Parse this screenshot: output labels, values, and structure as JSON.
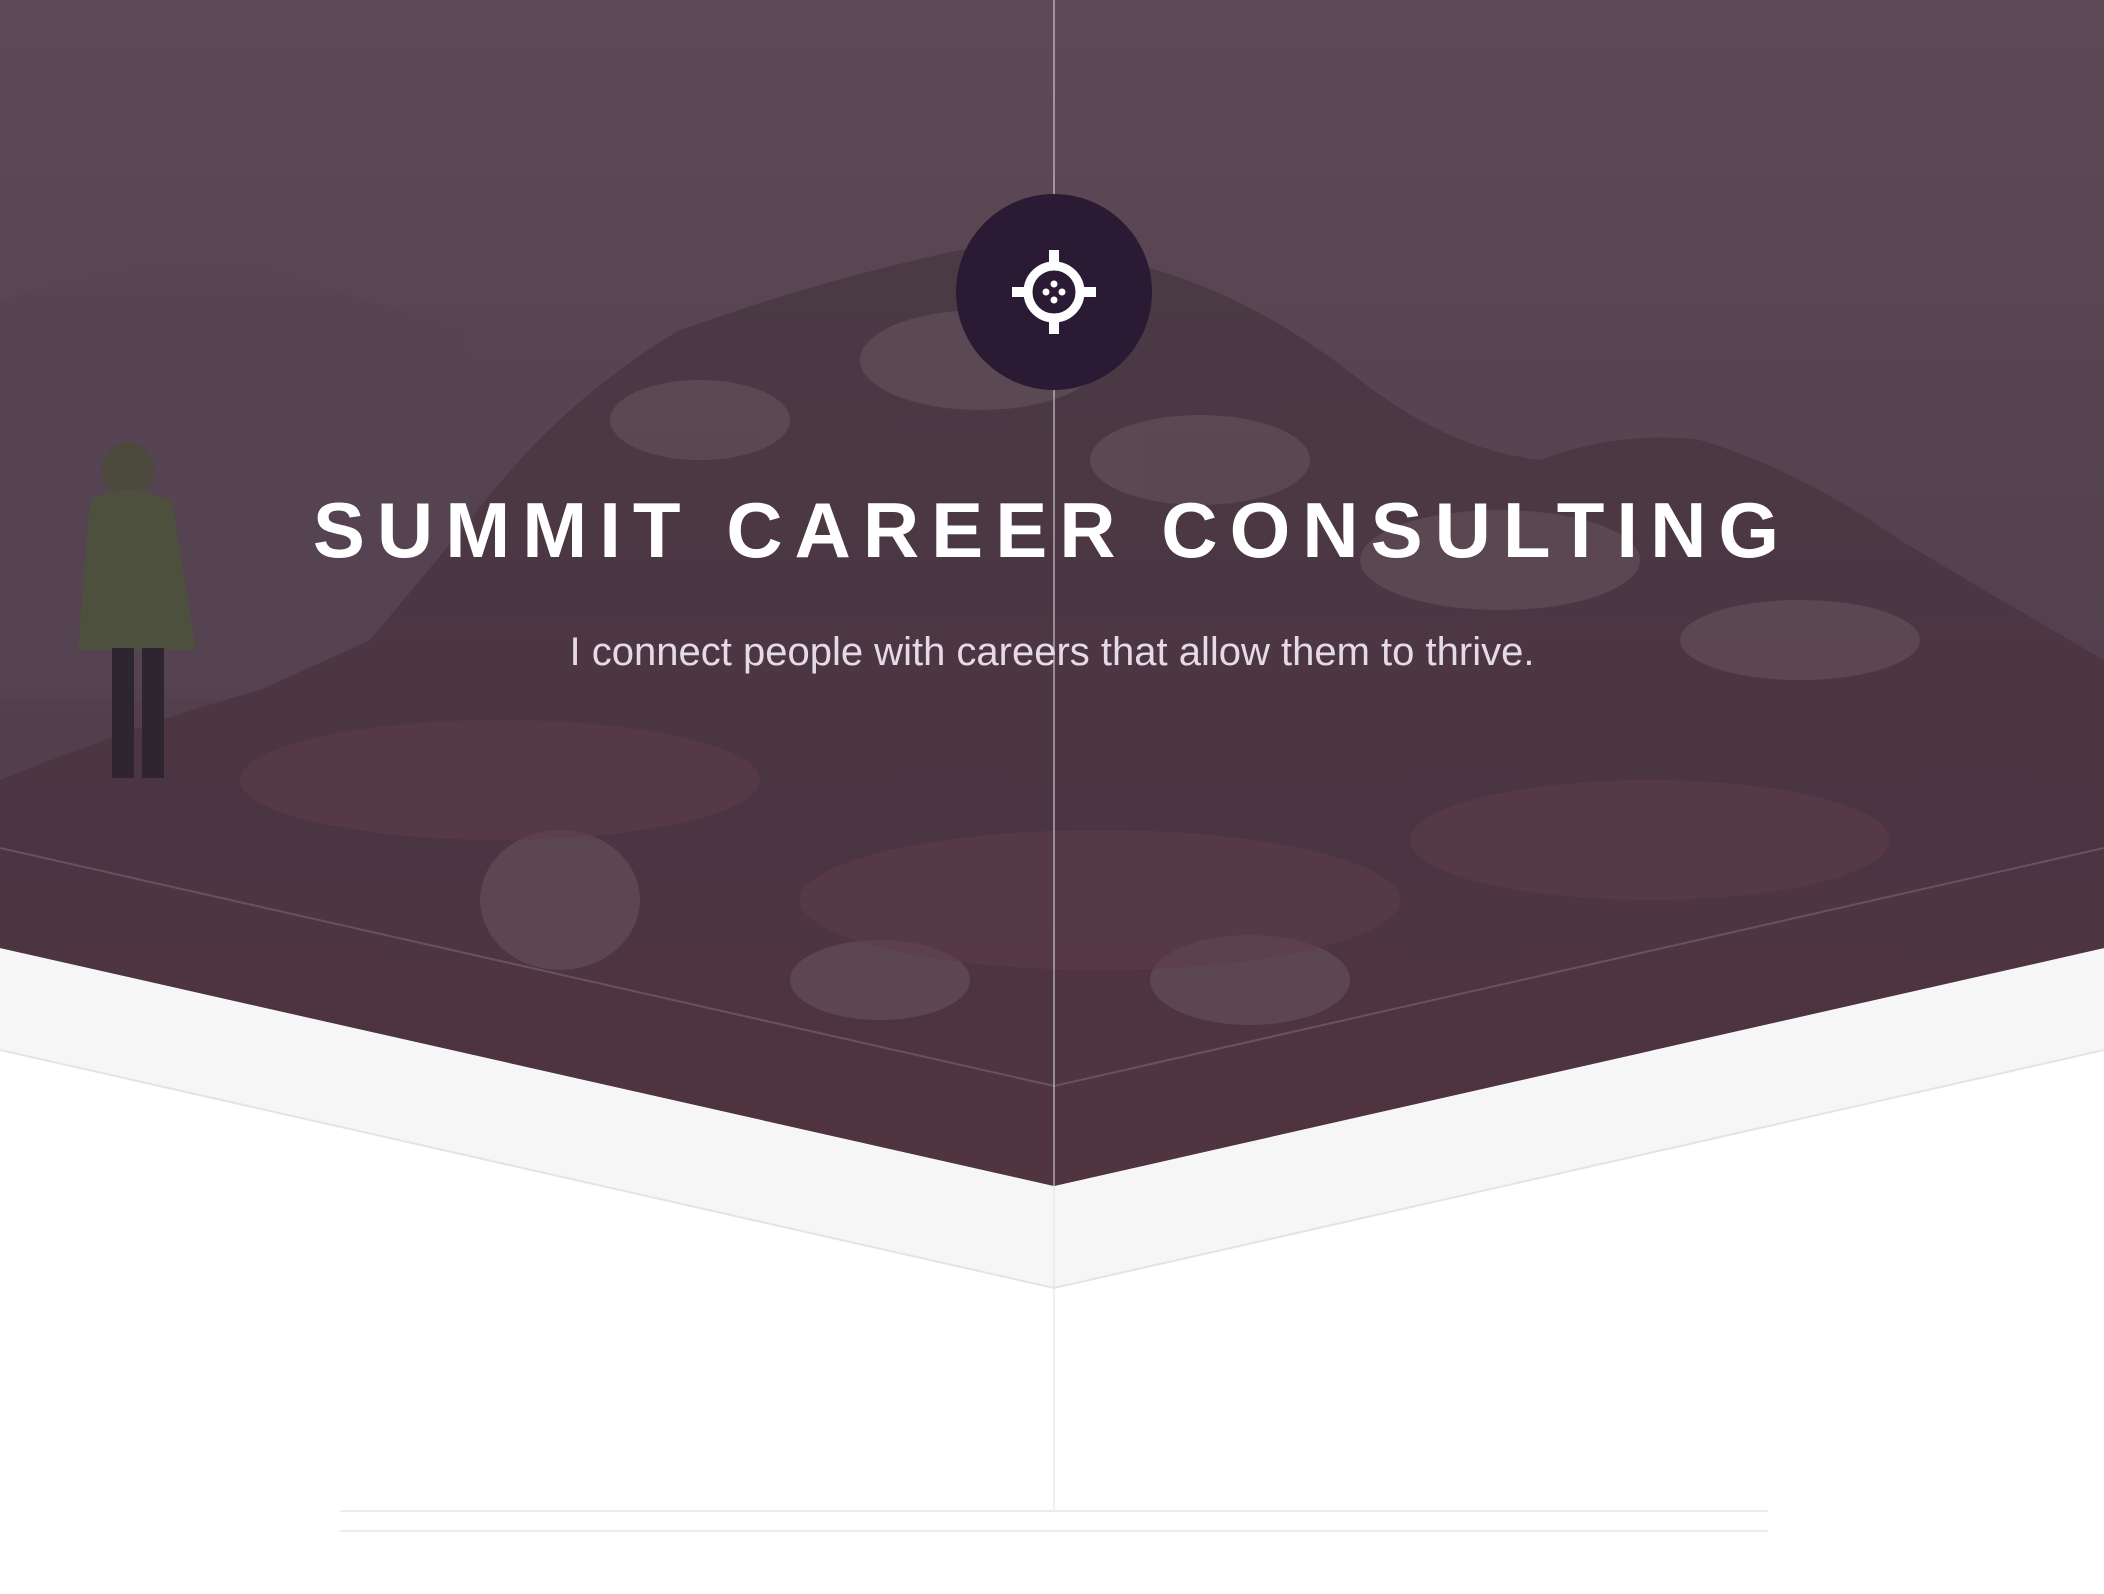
{
  "header": {
    "logo_icon": "crosshair-icon",
    "title": "SUMMIT CAREER CONSULTING",
    "tagline": "I connect people with careers that allow them to thrive."
  },
  "colors": {
    "hero_overlay": "#4f3c4b",
    "badge": "#2b1a34",
    "band": "#f6f6f6",
    "page": "#ffffff",
    "grid_line": "#e2e2e2"
  }
}
